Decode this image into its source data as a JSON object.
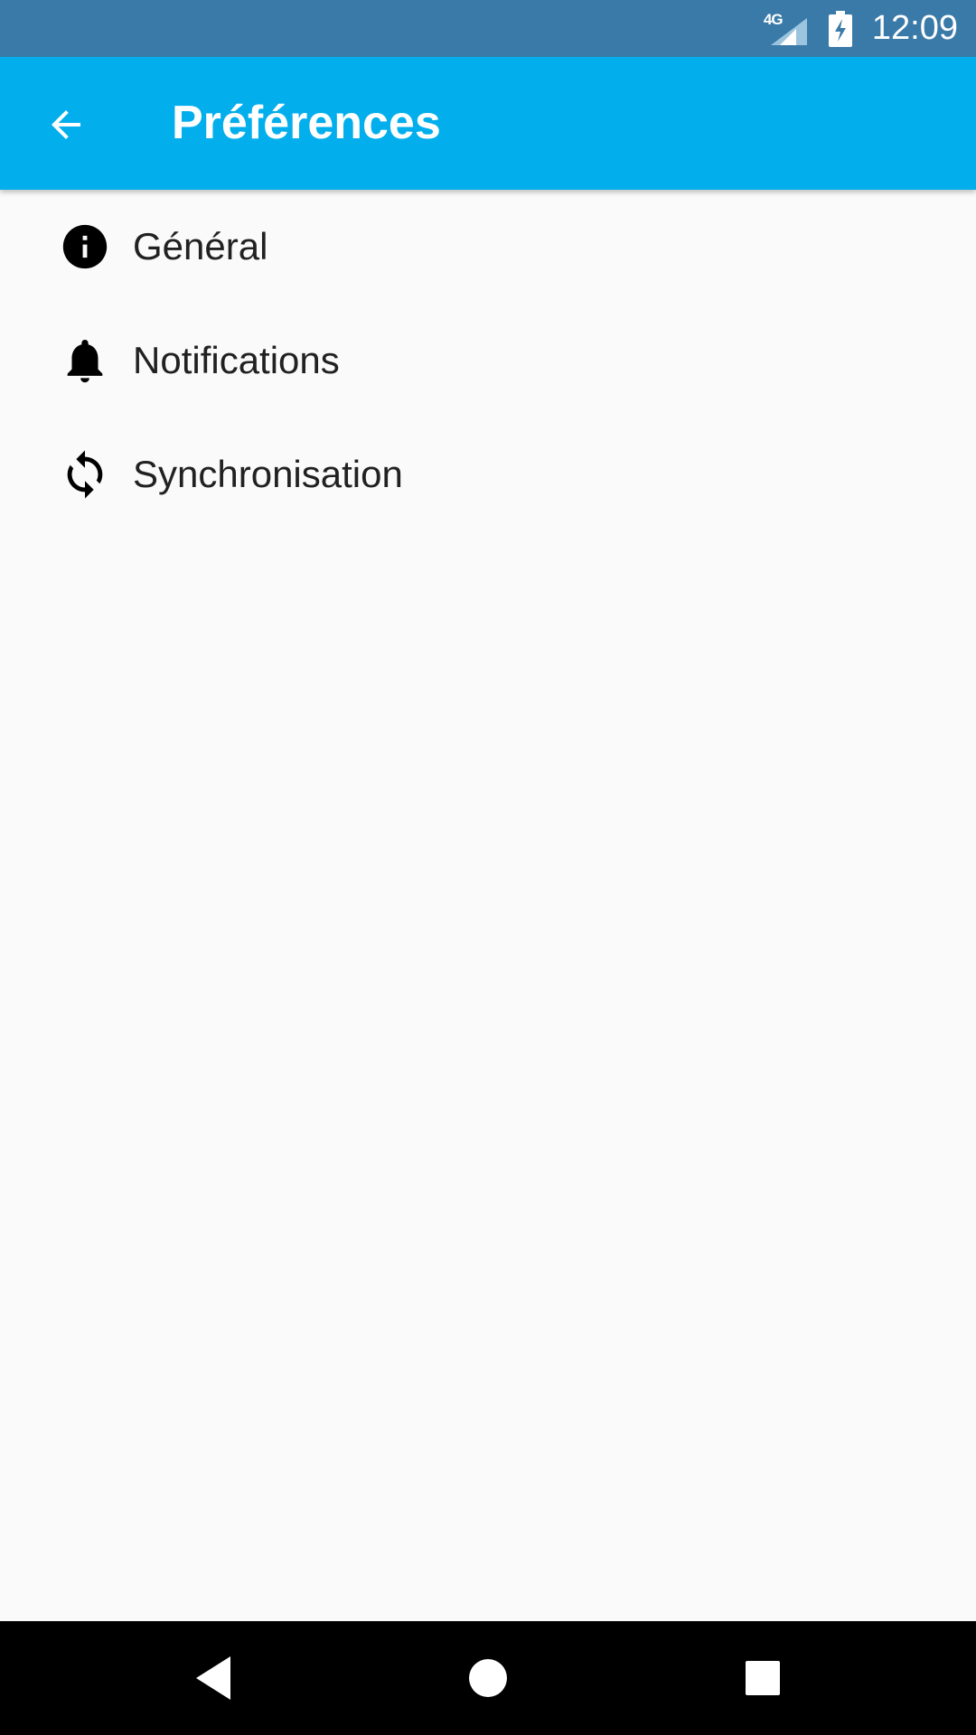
{
  "status_bar": {
    "network_type": "4G",
    "time": "12:09",
    "signal_icon": "signal-icon",
    "battery_icon": "battery-charging-icon"
  },
  "app_bar": {
    "title": "Préférences",
    "back_icon": "arrow-back-icon",
    "background_color": "#03aeed"
  },
  "preferences": [
    {
      "label": "Général",
      "icon": "info-icon"
    },
    {
      "label": "Notifications",
      "icon": "bell-icon"
    },
    {
      "label": "Synchronisation",
      "icon": "sync-icon"
    }
  ],
  "nav_bar": {
    "back_icon": "nav-back-icon",
    "home_icon": "nav-home-icon",
    "recents_icon": "nav-recents-icon"
  },
  "colors": {
    "status_bar": "#3a7aa8",
    "app_bar": "#03aeed",
    "background": "#fafafa",
    "text": "#212121"
  }
}
